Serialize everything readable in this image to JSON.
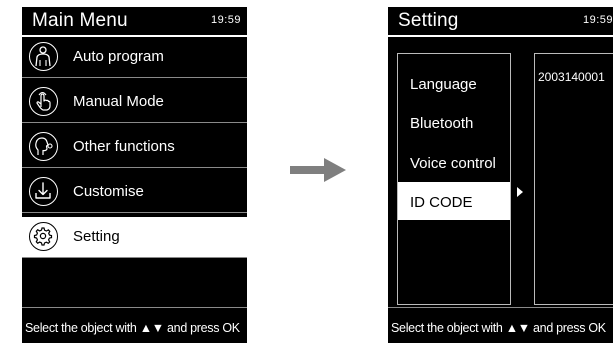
{
  "main_menu": {
    "title": "Main Menu",
    "time": "19:59",
    "items": [
      {
        "label": "Auto program",
        "icon": "body-figure-icon"
      },
      {
        "label": "Manual Mode",
        "icon": "hand-pointer-icon"
      },
      {
        "label": "Other functions",
        "icon": "head-profile-icon"
      },
      {
        "label": "Customise",
        "icon": "download-tray-icon"
      },
      {
        "label": "Setting",
        "icon": "gear-icon",
        "selected": true
      }
    ],
    "footer": "Select the object with ▲▼ and press OK"
  },
  "setting": {
    "title": "Setting",
    "time": "19:59",
    "items": [
      {
        "label": "Language"
      },
      {
        "label": "Bluetooth"
      },
      {
        "label": "Voice control"
      },
      {
        "label": "ID CODE",
        "selected": true
      }
    ],
    "value": "2003140001",
    "footer": "Select the object with ▲▼ and press OK"
  },
  "colors": {
    "screen_bg": "#000000",
    "highlight": "#ffffff",
    "arrow": "#7f7f7f"
  }
}
